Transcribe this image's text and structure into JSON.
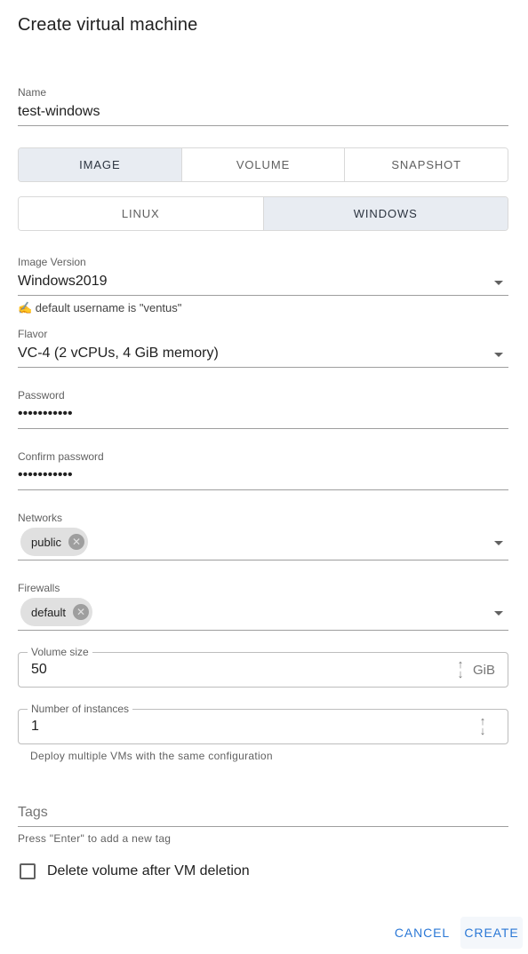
{
  "dialog": {
    "title": "Create virtual machine"
  },
  "name_field": {
    "label": "Name",
    "value": "test-windows"
  },
  "source_tabs": [
    {
      "label": "IMAGE",
      "active": true
    },
    {
      "label": "VOLUME",
      "active": false
    },
    {
      "label": "SNAPSHOT",
      "active": false
    }
  ],
  "os_tabs": [
    {
      "label": "LINUX",
      "active": false
    },
    {
      "label": "WINDOWS",
      "active": true
    }
  ],
  "image_version": {
    "label": "Image Version",
    "value": "Windows2019",
    "hint": "✍️ default username is \"ventus\""
  },
  "flavor": {
    "label": "Flavor",
    "value": "VC-4 (2 vCPUs, 4 GiB memory)"
  },
  "password": {
    "label": "Password",
    "value": "•••••••••••"
  },
  "confirm_password": {
    "label": "Confirm password",
    "value": "•••••••••••"
  },
  "networks": {
    "label": "Networks",
    "chips": [
      "public"
    ]
  },
  "firewalls": {
    "label": "Firewalls",
    "chips": [
      "default"
    ]
  },
  "volume_size": {
    "label": "Volume size",
    "value": "50",
    "unit": "GiB"
  },
  "instances": {
    "label": "Number of instances",
    "value": "1",
    "helper": "Deploy multiple VMs with the same configuration"
  },
  "tags": {
    "placeholder": "Tags",
    "helper": "Press \"Enter\" to add a new tag"
  },
  "delete_volume": {
    "label": "Delete volume after VM deletion",
    "checked": false
  },
  "actions": {
    "cancel": "CANCEL",
    "create": "CREATE"
  },
  "colors": {
    "accent": "#2b78d6",
    "active_tab_bg": "#e8ecf2"
  }
}
